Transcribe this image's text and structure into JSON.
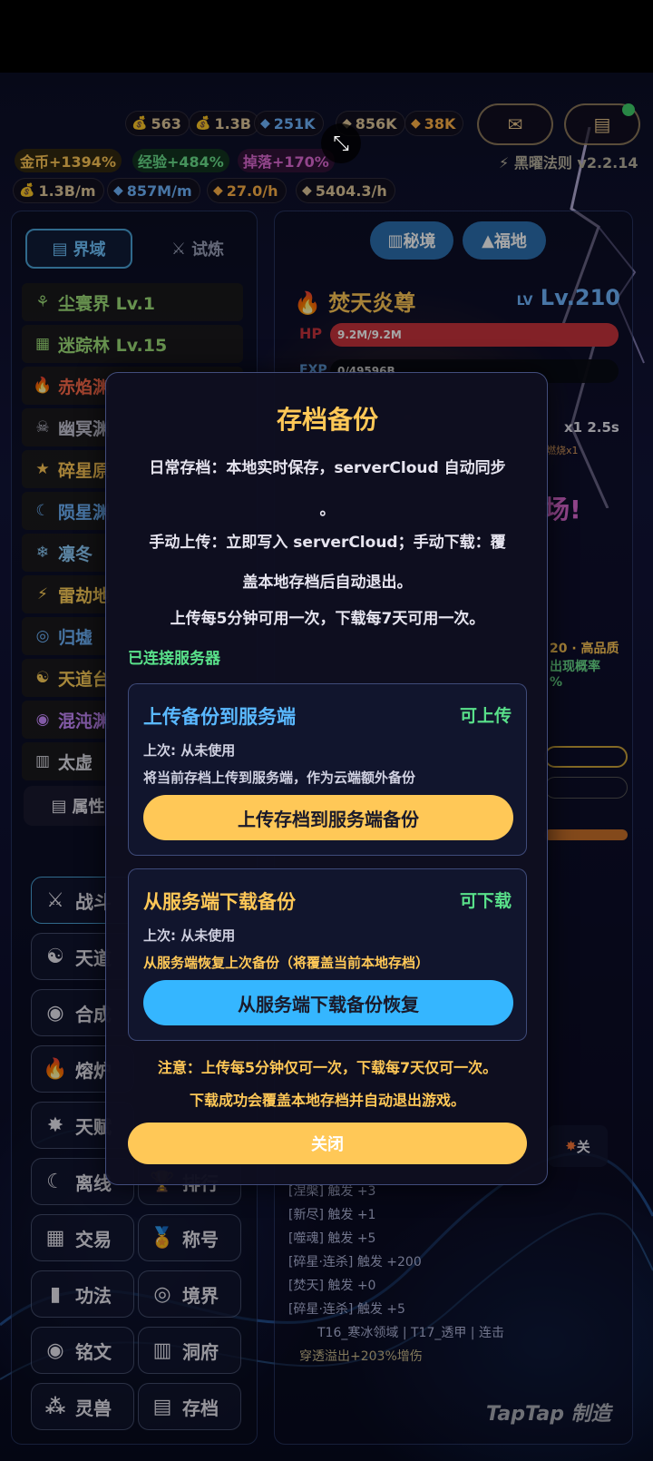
{
  "resources": [
    {
      "icon": "💰",
      "value": "563"
    },
    {
      "icon": "💰",
      "value": "1.3B"
    },
    {
      "icon": "◆",
      "value": "251K"
    },
    {
      "icon": "◆",
      "value": "856K"
    },
    {
      "icon": "◆",
      "value": "38K"
    }
  ],
  "bonuses": {
    "gold": "金币+1394%",
    "exp": "经验+484%",
    "drop": "掉落+170%"
  },
  "rates": {
    "gold": "1.3B/m",
    "spirit": "857M/m",
    "gem": "27.0/h",
    "other": "5404.3/h"
  },
  "version": "黑曜法则 v2.2.14",
  "left_tabs": {
    "realm": "界域",
    "trial": "试炼"
  },
  "realms": [
    {
      "icon": "⚘",
      "name": "尘寰界 Lv.1"
    },
    {
      "icon": "▦",
      "name": "迷踪林 Lv.15"
    },
    {
      "icon": "🔥",
      "name": "赤焰渊"
    },
    {
      "icon": "☠",
      "name": "幽冥渊"
    },
    {
      "icon": "★",
      "name": "碎星原"
    },
    {
      "icon": "☾",
      "name": "陨星渊"
    },
    {
      "icon": "❄",
      "name": "凛冬"
    },
    {
      "icon": "⚡",
      "name": "雷劫地"
    },
    {
      "icon": "◎",
      "name": "归墟"
    },
    {
      "icon": "☯",
      "name": "天道台"
    },
    {
      "icon": "◉",
      "name": "混沌渊"
    },
    {
      "icon": "▥",
      "name": "太虚"
    }
  ],
  "attr_tab": "属性",
  "nav": [
    {
      "icon": "⚔",
      "label": "战斗"
    },
    {
      "icon": "☯",
      "label": "天道"
    },
    {
      "icon": "◉",
      "label": "合成"
    },
    {
      "icon": "🔥",
      "label": "熔炉"
    },
    {
      "icon": "✸",
      "label": "天赋"
    },
    {
      "icon": "☾",
      "label": "离线"
    },
    {
      "icon": "🏆",
      "label": "排行"
    },
    {
      "icon": "▦",
      "label": "交易"
    },
    {
      "icon": "🏅",
      "label": "称号"
    },
    {
      "icon": "▮",
      "label": "功法"
    },
    {
      "icon": "◎",
      "label": "境界"
    },
    {
      "icon": "◉",
      "label": "铭文"
    },
    {
      "icon": "▥",
      "label": "洞府"
    },
    {
      "icon": "⁂",
      "label": "灵兽"
    },
    {
      "icon": "▤",
      "label": "存档"
    }
  ],
  "right": {
    "secret_label": "秘境",
    "fortune_label": "福地",
    "hero_name": "焚天炎尊",
    "level": "Lv.210",
    "lv_prefix": "LV",
    "hp_label": "HP",
    "hp_text": "9.2M/9.2M",
    "hp_ratio": 1.0,
    "exp_label": "EXP",
    "exp_text": "0/49596B",
    "exp_ratio": 0.0,
    "skill_speed": "x1 2.5s",
    "skill_tag": "燃烧x1",
    "banner_text": "场!",
    "quality_text": "20 · 高品质",
    "quality_sub": "出现概率",
    "percent_text": "%",
    "close_fragment": "关"
  },
  "combat_log": [
    "[涅槃] 触发 +3",
    "[新尽] 触发 +1",
    "[噬魂] 触发 +5",
    "[碎星·连杀] 触发 +200",
    "[焚天] 触发 +0",
    "[碎星·连杀] 触发 +5",
    "T16_寒冰领域 | T17_透甲 | 连击",
    "穿透溢出+203%增伤"
  ],
  "modal": {
    "title": "存档备份",
    "line1": "日常存档：本地实时保存，serverCloud 自动同步",
    "line1b": "。",
    "line2": "手动上传：立即写入 serverCloud；手动下载：覆",
    "line2b": "盖本地存档后自动退出。",
    "line3": "上传每5分钟可用一次，下载每7天可用一次。",
    "connected": "已连接服务器",
    "upload": {
      "title": "上传备份到服务端",
      "status": "可上传",
      "last": "上次: 从未使用",
      "desc": "将当前存档上传到服务端，作为云端额外备份",
      "button": "上传存档到服务端备份"
    },
    "download": {
      "title": "从服务端下载备份",
      "status": "可下载",
      "last": "上次: 从未使用",
      "desc": "从服务端恢复上次备份（将覆盖当前本地存档）",
      "button": "从服务端下载备份恢复"
    },
    "note1": "注意：上传每5分钟仅可一次，下载每7天仅可一次。",
    "note2": "下载成功会覆盖本地存档并自动退出游戏。",
    "close": "关闭"
  },
  "watermark": "TapTap 制造",
  "colors": {
    "gold": "#ffc857",
    "blue": "#35b6ff",
    "green": "#59e08a",
    "title_blue": "#5ab8ff",
    "hp_red": "#c8343c"
  }
}
